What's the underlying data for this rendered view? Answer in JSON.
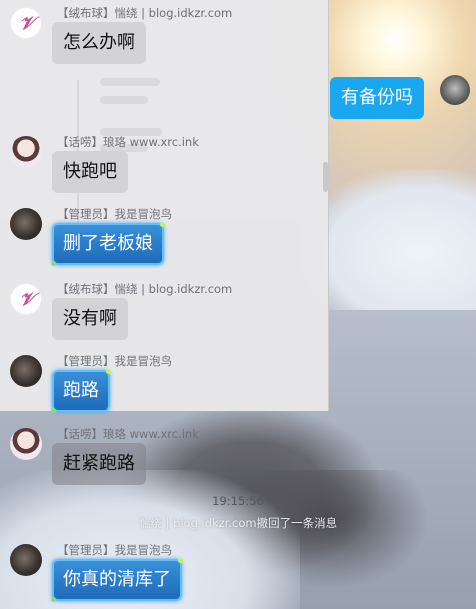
{
  "messages": [
    {
      "role": "【绒布球】",
      "name": "惴绕",
      "site": "blog.idkzr.com",
      "text": "怎么办啊",
      "avatar": "rong-avatar"
    },
    {
      "role": "",
      "name": "",
      "site": "",
      "text": "有备份吗",
      "avatar": "me-avatar",
      "self": true
    },
    {
      "role": "【话唠】",
      "name": "琅珞",
      "site": "www.xrc.ink",
      "text": "快跑吧",
      "avatar": "lang-avatar"
    },
    {
      "role": "【管理员】",
      "name": "我是冒泡鸟",
      "site": "",
      "text": "删了老板娘",
      "avatar": "admin-avatar"
    },
    {
      "role": "【绒布球】",
      "name": "惴绕",
      "site": "blog.idkzr.com",
      "text": "没有啊",
      "avatar": "rong-avatar"
    },
    {
      "role": "【管理员】",
      "name": "我是冒泡鸟",
      "site": "",
      "text": "跑路",
      "avatar": "admin-avatar"
    },
    {
      "role": "【话唠】",
      "name": "琅珞",
      "site": "www.xrc.ink",
      "text": "赶紧跑路",
      "avatar": "lang-avatar"
    },
    {
      "role": "【管理员】",
      "name": "我是冒泡鸟",
      "site": "",
      "text": "你真的清库了",
      "avatar": "admin-avatar"
    }
  ],
  "meta_lines": {
    "m0": "【绒布球】惴绕 | blog.idkzr.com",
    "m2": "【话唠】琅珞 www.xrc.ink",
    "m3": "【管理员】我是冒泡鸟",
    "m4": "【绒布球】惴绕 | blog.idkzr.com",
    "m5": "【管理员】我是冒泡鸟",
    "m6": "【话唠】琅珞 www.xrc.ink",
    "m7": "【管理员】我是冒泡鸟"
  },
  "avatar_letters": {
    "rong": "𝒱"
  },
  "timestamp": "19:15:56",
  "recall_notice": "惴绕 | blog.idkzr.com撤回了一条消息",
  "colors": {
    "self_bubble": "#19a8f0",
    "admin_bubble": "#1d6bb9",
    "gray_bubble": "#d3d3d6"
  }
}
